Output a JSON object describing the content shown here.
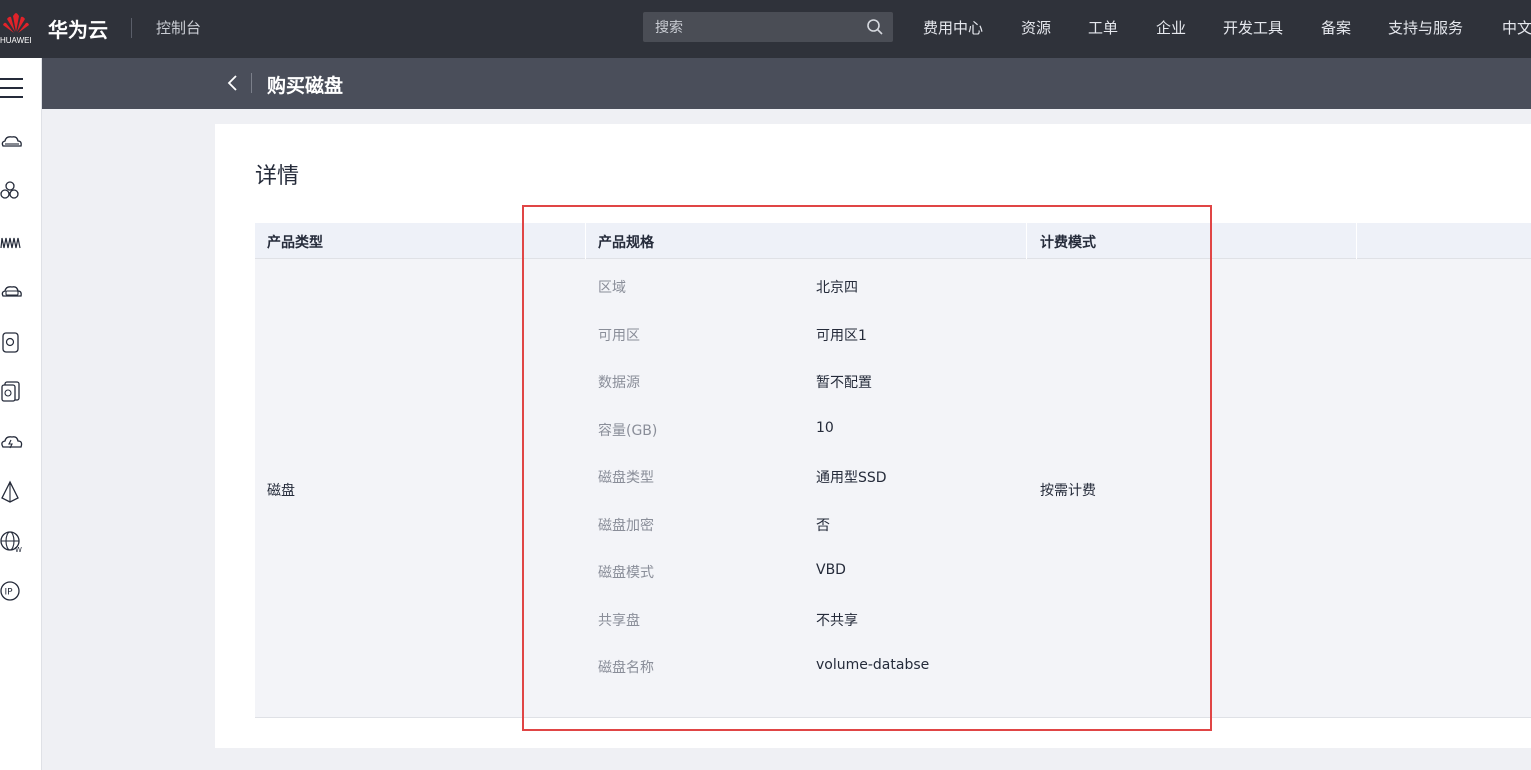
{
  "header": {
    "logo_text": "HUAWEI",
    "brand": "华为云",
    "console": "控制台",
    "search_placeholder": "搜索",
    "nav": [
      "费用中心",
      "资源",
      "工单",
      "企业",
      "开发工具",
      "备案",
      "支持与服务",
      "中文"
    ]
  },
  "sidebar": {
    "icons": [
      "menu-icon",
      "cloud-server-icon",
      "hexagon-cluster-icon",
      "network-wave-icon",
      "cloud-database-icon",
      "disk-icon",
      "storage-backup-icon",
      "cloud-lightning-icon",
      "sail-icon",
      "globe-w-icon",
      "ip-icon"
    ]
  },
  "subheader": {
    "title": "购买磁盘"
  },
  "details": {
    "title": "详情",
    "columns": [
      "产品类型",
      "产品规格",
      "计费模式"
    ],
    "product_type": "磁盘",
    "billing_mode": "按需计费",
    "specs": [
      {
        "label": "区域",
        "value": "北京四"
      },
      {
        "label": "可用区",
        "value": "可用区1"
      },
      {
        "label": "数据源",
        "value": "暂不配置"
      },
      {
        "label": "容量(GB)",
        "value": "10"
      },
      {
        "label": "磁盘类型",
        "value": "通用型SSD"
      },
      {
        "label": "磁盘加密",
        "value": "否"
      },
      {
        "label": "磁盘模式",
        "value": "VBD"
      },
      {
        "label": "共享盘",
        "value": "不共享"
      },
      {
        "label": "磁盘名称",
        "value": "volume-databse"
      }
    ]
  },
  "colors": {
    "topbar": "#2f323a",
    "subheader": "#4a4e5a",
    "highlight": "#e04545"
  }
}
